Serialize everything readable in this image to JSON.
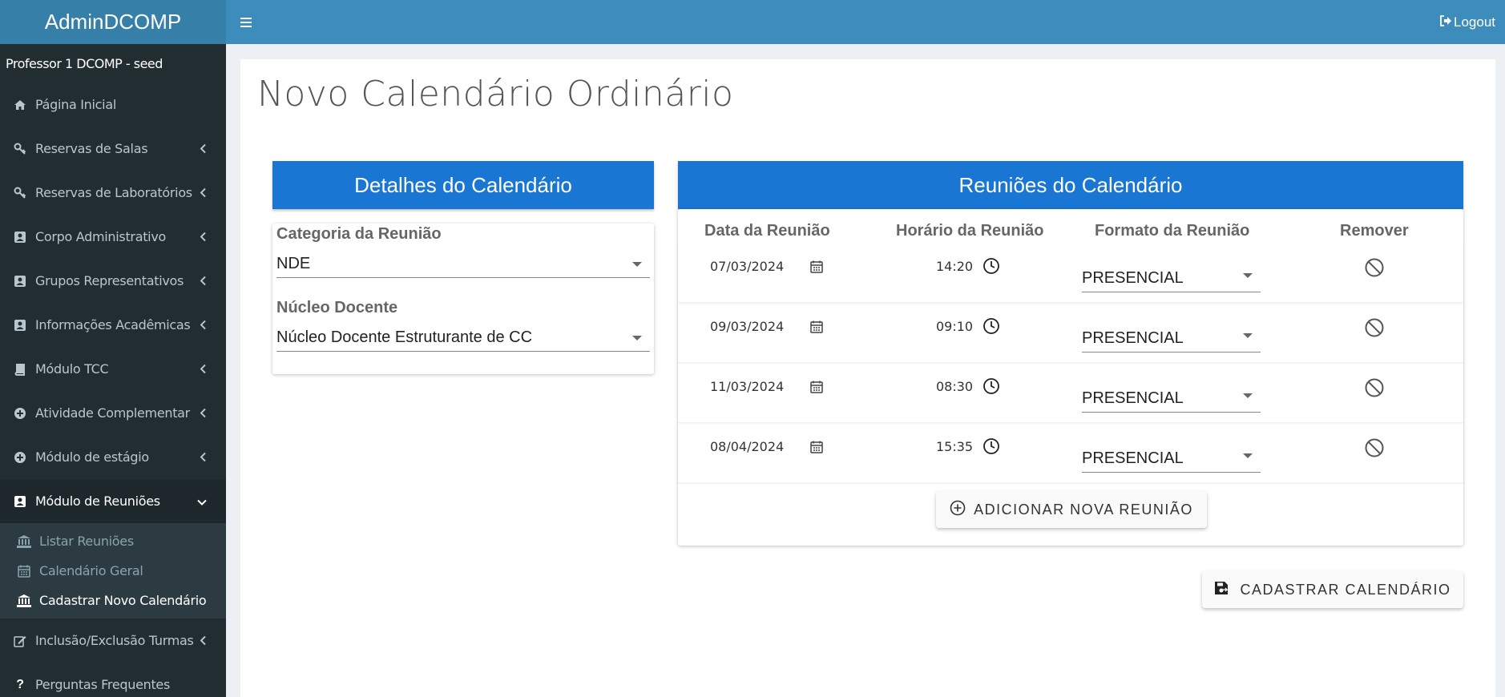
{
  "app": {
    "brand": "AdminDCOMP",
    "user": "Professor 1 DCOMP - seed",
    "logout_label": "Logout"
  },
  "sidebar": {
    "items": [
      {
        "label": "Página Inicial",
        "icon": "home-icon"
      },
      {
        "label": "Reservas de Salas",
        "icon": "key-icon"
      },
      {
        "label": "Reservas de Laboratórios",
        "icon": "key-icon"
      },
      {
        "label": "Corpo Administrativo",
        "icon": "id-card-icon"
      },
      {
        "label": "Grupos Representativos",
        "icon": "id-card-icon"
      },
      {
        "label": "Informações Acadêmicas",
        "icon": "id-card-icon"
      },
      {
        "label": "Módulo TCC",
        "icon": "book-icon"
      },
      {
        "label": "Atividade Complementar",
        "icon": "plus-circle-icon"
      },
      {
        "label": "Módulo de estágio",
        "icon": "plus-circle-icon"
      },
      {
        "label": "Módulo de Reuniões",
        "icon": "id-card-icon"
      },
      {
        "label": "Inclusão/Exclusão Turmas",
        "icon": "edit-icon"
      },
      {
        "label": "Perguntas Frequentes",
        "icon": "question-icon"
      }
    ],
    "submenu": [
      {
        "label": "Listar Reuniões",
        "icon": "bank-icon"
      },
      {
        "label": "Calendário Geral",
        "icon": "calendar-icon"
      },
      {
        "label": "Cadastrar Novo Calendário",
        "icon": "bank-icon"
      }
    ]
  },
  "page": {
    "title": "Novo Calendário Ordinário"
  },
  "details": {
    "header": "Detalhes do Calendário",
    "category_label": "Categoria da Reunião",
    "category_value": "NDE",
    "nucleus_label": "Núcleo Docente",
    "nucleus_value": "Núcleo Docente Estruturante de CC"
  },
  "meetings": {
    "header": "Reuniões do Calendário",
    "columns": [
      "Data da Reunião",
      "Horário da Reunião",
      "Formato da Reunião",
      "Remover"
    ],
    "rows": [
      {
        "date": "07/03/2024",
        "time": "14:20",
        "format": "PRESENCIAL"
      },
      {
        "date": "09/03/2024",
        "time": "09:10",
        "format": "PRESENCIAL"
      },
      {
        "date": "11/03/2024",
        "time": "08:30",
        "format": "PRESENCIAL"
      },
      {
        "date": "08/04/2024",
        "time": "15:35",
        "format": "PRESENCIAL"
      }
    ],
    "add_label": "ADICIONAR NOVA REUNIÃO"
  },
  "actions": {
    "save_label": "CADASTRAR CALENDÁRIO"
  },
  "colors": {
    "sidebar": "#222d32",
    "topbar": "#3c8dbc",
    "brand": "#367fa9",
    "card_header": "#1976d2"
  }
}
